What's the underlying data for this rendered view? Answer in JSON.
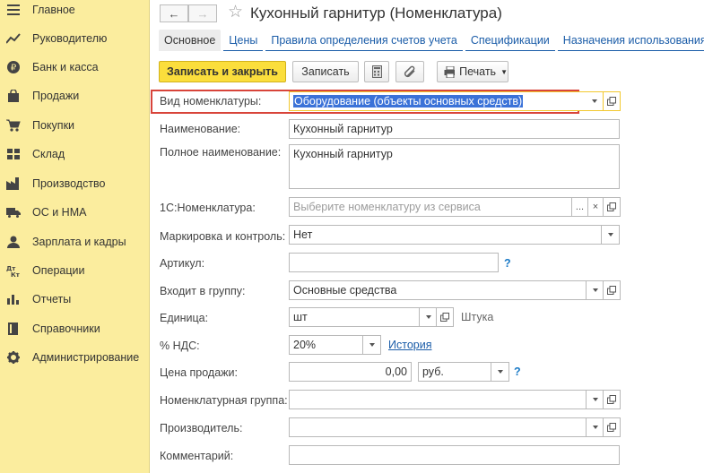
{
  "sidebar": {
    "items": [
      {
        "label": "Главное",
        "icon": "menu-icon"
      },
      {
        "label": "Руководителю",
        "icon": "trend-chart-icon"
      },
      {
        "label": "Банк и касса",
        "icon": "ruble-coin-icon"
      },
      {
        "label": "Продажи",
        "icon": "shopping-bag-icon"
      },
      {
        "label": "Покупки",
        "icon": "shopping-cart-icon"
      },
      {
        "label": "Склад",
        "icon": "warehouse-icon"
      },
      {
        "label": "Производство",
        "icon": "factory-icon"
      },
      {
        "label": "ОС и НМА",
        "icon": "truck-icon"
      },
      {
        "label": "Зарплата и кадры",
        "icon": "person-icon"
      },
      {
        "label": "Операции",
        "icon": "operations-icon"
      },
      {
        "label": "Отчеты",
        "icon": "bar-chart-icon"
      },
      {
        "label": "Справочники",
        "icon": "book-icon"
      },
      {
        "label": "Администрирование",
        "icon": "gear-icon"
      }
    ]
  },
  "header": {
    "title": "Кухонный гарнитур (Номенклатура)",
    "back_icon": "←",
    "forward_icon": "→",
    "star_icon": "☆"
  },
  "tabs": [
    {
      "label": "Основное",
      "active": true
    },
    {
      "label": "Цены",
      "active": false
    },
    {
      "label": "Правила определения счетов учета",
      "active": false
    },
    {
      "label": "Спецификации",
      "active": false
    },
    {
      "label": "Назначения использования",
      "active": false
    }
  ],
  "toolbar": {
    "save_close_label": "Записать и закрыть",
    "save_label": "Записать",
    "print_label": "Печать"
  },
  "form": {
    "kind": {
      "label": "Вид номенклатуры:",
      "value": "Оборудование (объекты основных средств)"
    },
    "name": {
      "label": "Наименование:",
      "value": "Кухонный гарнитур"
    },
    "full_name": {
      "label": "Полное наименование:",
      "value": "Кухонный гарнитур"
    },
    "nomenclature_1c": {
      "label": "1С:Номенклатура:",
      "placeholder": "Выберите номенклатуру из сервиса",
      "dots": "...",
      "clear": "×"
    },
    "marking": {
      "label": "Маркировка и контроль:",
      "value": "Нет"
    },
    "article": {
      "label": "Артикул:",
      "value": "",
      "help": "?"
    },
    "group": {
      "label": "Входит в группу:",
      "value": "Основные средства"
    },
    "unit": {
      "label": "Единица:",
      "value": "шт",
      "hint": "Штука"
    },
    "vat": {
      "label": "% НДС:",
      "value": "20%",
      "history_link": "История"
    },
    "price": {
      "label": "Цена продажи:",
      "value": "0,00",
      "currency": "руб.",
      "help": "?"
    },
    "nomenclature_group": {
      "label": "Номенклатурная группа:",
      "value": ""
    },
    "manufacturer": {
      "label": "Производитель:",
      "value": ""
    },
    "comment": {
      "label": "Комментарий:",
      "value": ""
    }
  },
  "colors": {
    "sidebar_bg": "#fbed9e",
    "primary_button": "#fbde3c",
    "link": "#1a5ca8",
    "highlight_border": "#d8443a",
    "focus_border": "#f2c82e",
    "selection": "#3b72d8"
  }
}
